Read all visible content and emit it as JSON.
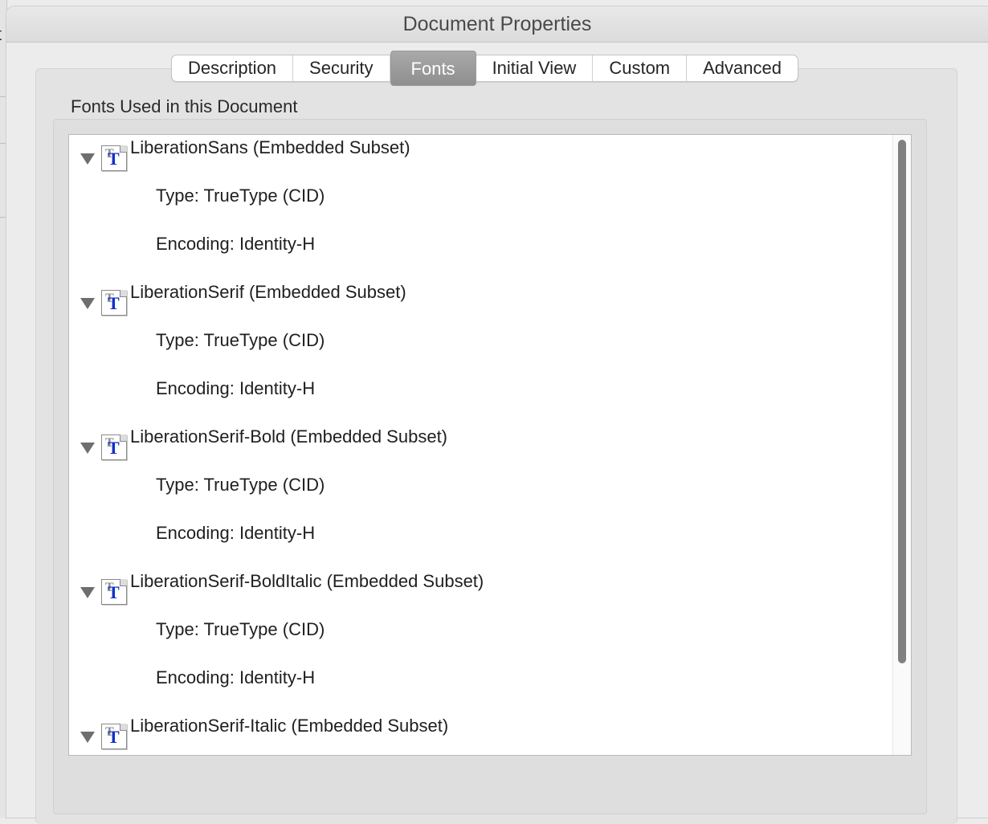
{
  "window": {
    "title": "Document Properties"
  },
  "tabs": [
    {
      "label": "Description",
      "active": false
    },
    {
      "label": "Security",
      "active": false
    },
    {
      "label": "Fonts",
      "active": true
    },
    {
      "label": "Initial View",
      "active": false
    },
    {
      "label": "Custom",
      "active": false
    },
    {
      "label": "Advanced",
      "active": false
    }
  ],
  "fonts_section": {
    "label": "Fonts Used in this Document",
    "fonts": [
      {
        "name": "LiberationSans (Embedded Subset)",
        "type": "Type: TrueType (CID)",
        "encoding": "Encoding: Identity-H",
        "expanded": true
      },
      {
        "name": "LiberationSerif (Embedded Subset)",
        "type": "Type: TrueType (CID)",
        "encoding": "Encoding: Identity-H",
        "expanded": true
      },
      {
        "name": "LiberationSerif-Bold (Embedded Subset)",
        "type": "Type: TrueType (CID)",
        "encoding": "Encoding: Identity-H",
        "expanded": true
      },
      {
        "name": "LiberationSerif-BoldItalic (Embedded Subset)",
        "type": "Type: TrueType (CID)",
        "encoding": "Encoding: Identity-H",
        "expanded": true
      },
      {
        "name": "LiberationSerif-Italic (Embedded Subset)",
        "type": "",
        "encoding": "",
        "expanded": true
      }
    ]
  },
  "icons": {
    "font_icon": "truetype-font-icon",
    "disclosure": "disclosure-triangle-expanded-icon"
  },
  "colors": {
    "active_tab": "#9a9a9a",
    "font_glyph": "#1030c8",
    "scroll_thumb": "#808080"
  }
}
